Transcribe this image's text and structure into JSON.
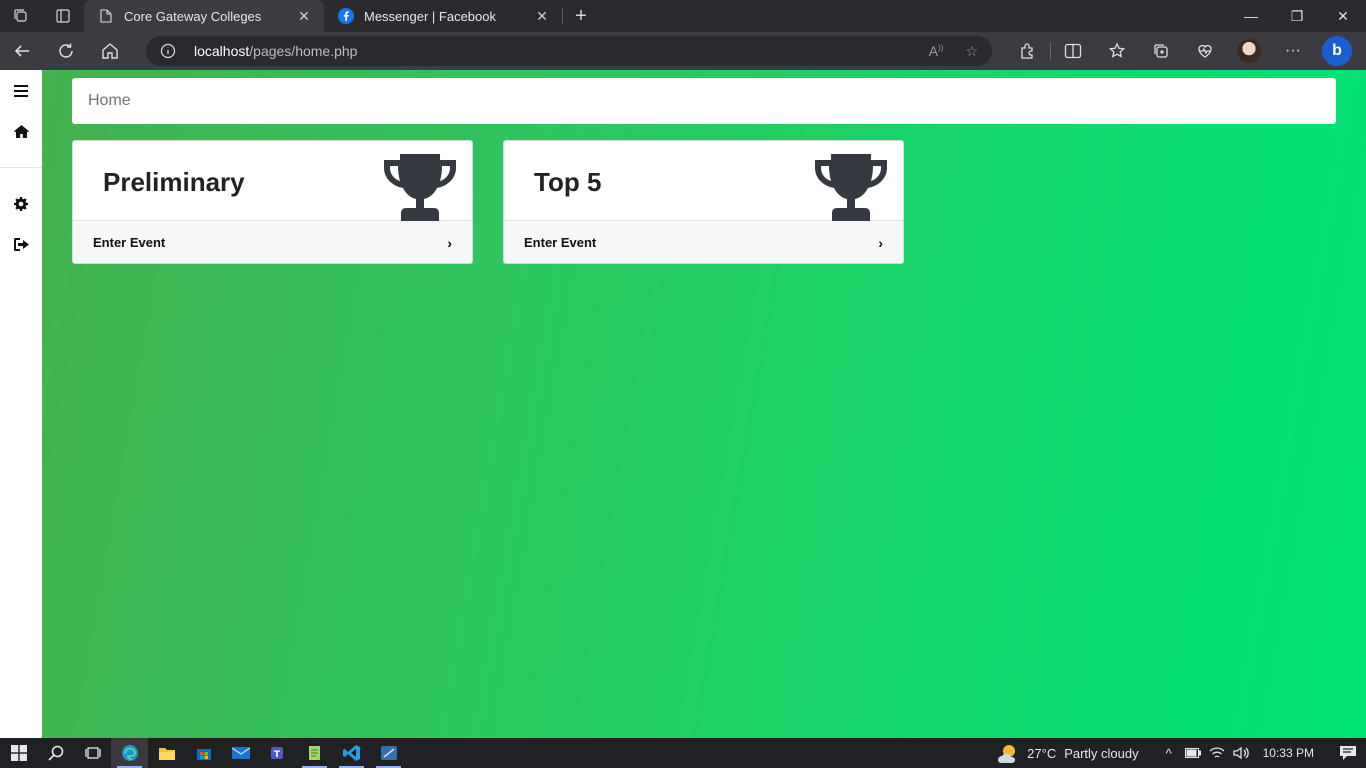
{
  "browser": {
    "tabs": [
      {
        "title": "Core Gateway Colleges",
        "active": true,
        "favicon": "page-icon"
      },
      {
        "title": "Messenger | Facebook",
        "active": false,
        "favicon": "facebook-icon"
      }
    ],
    "address": {
      "host": "localhost",
      "path": "/pages/home.php"
    }
  },
  "sidebar": {
    "items": [
      "menu-icon",
      "home-icon",
      "settings-icon",
      "logout-icon"
    ]
  },
  "breadcrumb": {
    "label": "Home"
  },
  "cards": [
    {
      "title": "Preliminary",
      "footer_label": "Enter Event",
      "icon": "trophy-icon"
    },
    {
      "title": "Top 5",
      "footer_label": "Enter Event",
      "icon": "trophy-icon"
    }
  ],
  "colors": {
    "bg_start": "#46b04c",
    "bg_end": "#00e676",
    "accent": "#1a5fd0"
  },
  "taskbar": {
    "weather": {
      "temp": "27°C",
      "condition": "Partly cloudy"
    },
    "time": "10:33 PM"
  }
}
